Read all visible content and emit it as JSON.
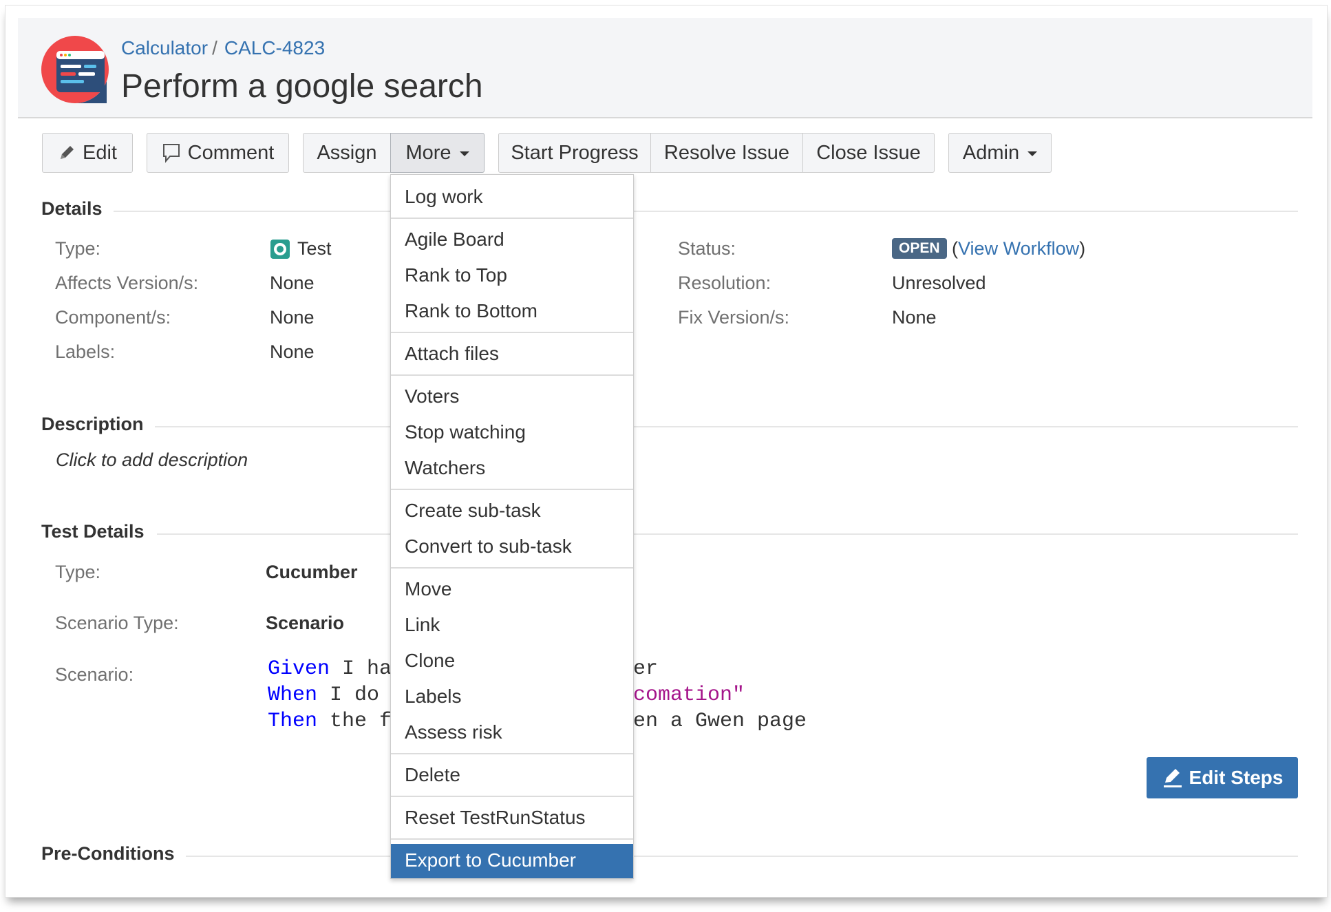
{
  "breadcrumb": {
    "project": "Calculator",
    "separator": "/",
    "issue_key": "CALC-4823"
  },
  "issue_title": "Perform a google search",
  "toolbar": {
    "edit": "Edit",
    "comment": "Comment",
    "assign": "Assign",
    "more": "More",
    "start_progress": "Start Progress",
    "resolve_issue": "Resolve Issue",
    "close_issue": "Close Issue",
    "admin": "Admin"
  },
  "details": {
    "title": "Details",
    "type_label": "Type:",
    "type_value": "Test",
    "affects_label": "Affects Version/s:",
    "affects_value": "None",
    "component_label": "Component/s:",
    "component_value": "None",
    "labels_label": "Labels:",
    "labels_value": "None",
    "status_label": "Status:",
    "status_badge": "OPEN",
    "status_link_open": "(",
    "status_link": "View Workflow",
    "status_link_close": ")",
    "resolution_label": "Resolution:",
    "resolution_value": "Unresolved",
    "fix_label": "Fix Version/s:",
    "fix_value": "None"
  },
  "description": {
    "title": "Description",
    "placeholder": "Click to add description"
  },
  "test_details": {
    "title": "Test Details",
    "type_label": "Type:",
    "type_value": "Cucumber",
    "scenario_type_label": "Scenario Type:",
    "scenario_type_value": "Scenario",
    "scenario_label": "Scenario:",
    "scenario_lines": [
      {
        "kw": "Given",
        "left": " I hav",
        "right": "er"
      },
      {
        "kw": "When",
        "left": " I do c",
        "right": "comation\""
      },
      {
        "kw": "Then",
        "left": " the fi",
        "right": "en a Gwen page"
      }
    ],
    "edit_steps": "Edit Steps"
  },
  "preconditions": {
    "title": "Pre-Conditions"
  },
  "more_menu": {
    "items": [
      "Log work",
      "Agile Board",
      "Rank to Top",
      "Rank to Bottom",
      "Attach files",
      "Voters",
      "Stop watching",
      "Watchers",
      "Create sub-task",
      "Convert to sub-task",
      "Move",
      "Link",
      "Clone",
      "Labels",
      "Assess risk",
      "Delete",
      "Reset TestRunStatus",
      "Export to Cucumber"
    ],
    "highlighted": "Export to Cucumber"
  },
  "colors": {
    "accent": "#3572b0",
    "status_badge": "#4a6785",
    "keyword": "#0000ff",
    "string": "#a5158b"
  }
}
